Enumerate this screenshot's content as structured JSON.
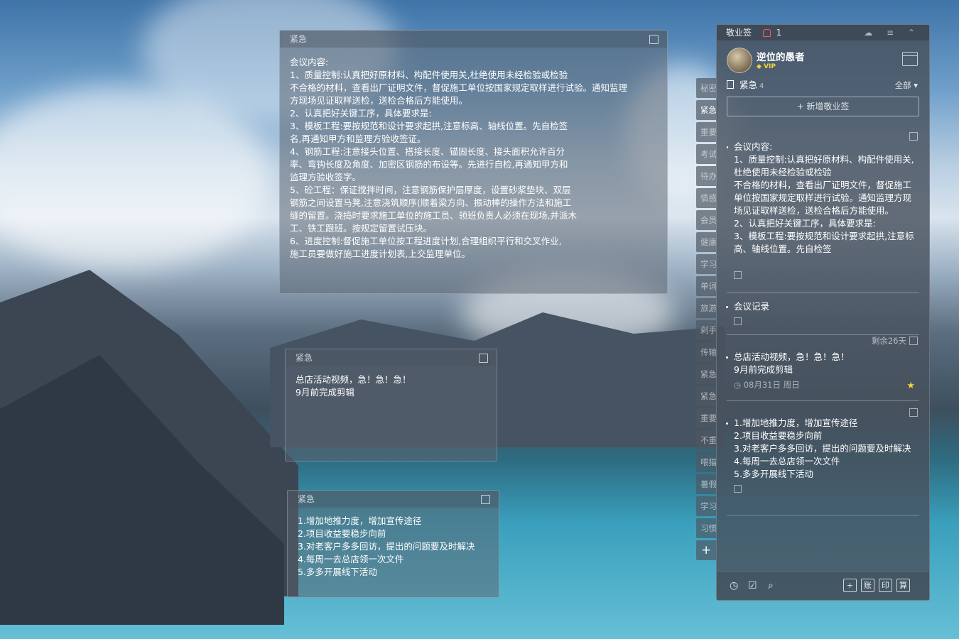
{
  "notes": [
    {
      "category": "紧急",
      "lines": [
        "会议内容:",
        "1、质量控制:认真把好原材料、构配件使用关,杜绝使用未经检验或检验",
        "不合格的材料，查看出厂证明文件，督促施工单位按国家规定取样进行试验。通知监理",
        "方现场见证取样送检，送检合格后方能使用。",
        "2、认真把好关键工序，具体要求是:",
        "3、模板工程:要按规范和设计要求起拱,注意标高、轴线位置。先自检签",
        "名,再通知甲方和监理方验收签证。",
        "4、钢筋工程:注意接头位置、搭接长度、锚固长度、接头面积允许百分",
        "率、弯钩长度及角度、加密区钢筋的布设等。先进行自检,再通知甲方和",
        "监理方验收签字。",
        "5、砼工程：保证搅拌时间，注意钢筋保护层厚度，设置砂浆垫块、双层",
        "钢筋之间设置马凳,注意浇筑顺序(顺着梁方向、振动棒的操作方法和施工",
        "缝的留置。浇捣时要求施工单位的施工员、领班负责人必须在现场,并派木",
        "工、铁工跟班。按规定留置试压块。",
        "6、进度控制:督促施工单位按工程进度计划,合理组织平行和交叉作业,",
        "施工员要做好施工进度计划表,上交监理单位。"
      ]
    },
    {
      "category": "紧急",
      "lines": [
        "总店活动视频，急！急！急！",
        "9月前完成剪辑"
      ]
    },
    {
      "category": "紧急",
      "lines": [
        "1.增加地推力度，增加宣传途径",
        "2.项目收益要稳步向前",
        "3.对老客户多多回访，提出的问题要及时解决",
        "4.每周一去总店领一次文件",
        "5.多多开展线下活动"
      ]
    }
  ],
  "tabs": [
    "秘密",
    "紧急",
    "重要",
    "考试",
    "待办",
    "情感",
    "会员",
    "健康",
    "学习",
    "单词",
    "旅游",
    "剁手",
    "传输",
    "紧急",
    "紧急",
    "重要",
    "不重",
    "喂猫",
    "暑假",
    "学习",
    "习惯"
  ],
  "tab_add": "+",
  "panel": {
    "app_title": "敬业签",
    "notification_count": "1",
    "window_controls": "☁ ≡ ⌃",
    "username": "逆位的愚者",
    "vip": "VIP",
    "category": "紧急",
    "category_count": "4",
    "filter": "全部 ▾",
    "new_button": "+ 新增敬业签",
    "items": [
      {
        "text": "会议内容:\n1、质量控制:认真把好原材料、构配件使用关,杜绝使用未经检验或检验\n不合格的材料，查看出厂证明文件，督促施工单位按国家规定取样进行试验。通知监理方现场见证取样送检，送检合格后方能使用。\n2、认真把好关键工序，具体要求是:\n3、模板工程:要按规范和设计要求起拱,注意标高、轴线位置。先自检签"
      },
      {
        "text": "会议记录"
      },
      {
        "remaining": "剩余26天",
        "text": "总店活动视频，急！急！急！\n9月前完成剪辑",
        "date": "08月31日 周日"
      },
      {
        "text": "1.增加地推力度，增加宣传途径\n2.项目收益要稳步向前\n3.对老客户多多回访，提出的问题要及时解决\n4.每周一去总店领一次文件\n5.多多开展线下活动"
      }
    ],
    "bottom_right": [
      "+",
      "账",
      "印",
      "算"
    ]
  }
}
